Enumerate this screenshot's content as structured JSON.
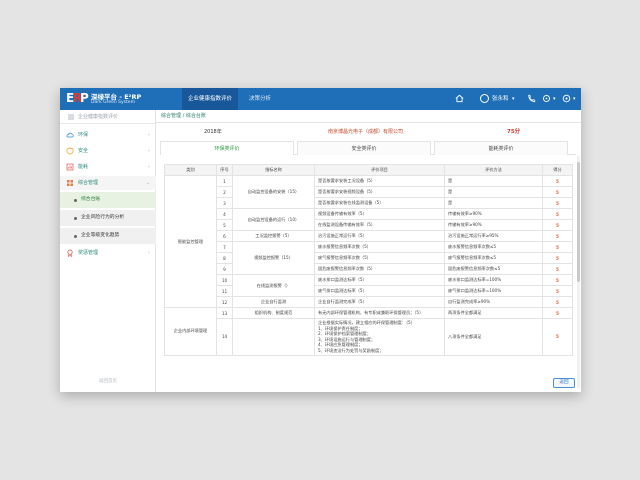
{
  "app": {
    "brand_title": "深绿平台 - E²RP",
    "brand_subtitle": "Dark Green System",
    "logo_letters": [
      "E",
      "R",
      "P"
    ]
  },
  "topnav": {
    "items": [
      {
        "label": "企业健康指数评价",
        "active": true
      },
      {
        "label": "决策分析",
        "active": false
      }
    ],
    "user_name": "张永和",
    "icons": [
      "home-icon",
      "user-icon",
      "phone-icon",
      "settings-icon",
      "help-icon"
    ]
  },
  "sidebar": {
    "title": "企业健康指数评价",
    "items": [
      {
        "label": "环保",
        "icon": "cloud-icon"
      },
      {
        "label": "安全",
        "icon": "shield-icon"
      },
      {
        "label": "能耗",
        "icon": "energy-icon"
      },
      {
        "label": "综合管理",
        "icon": "grid-icon",
        "open": true
      },
      {
        "label": "奖惩管理",
        "icon": "award-icon"
      }
    ],
    "sub_items": [
      {
        "label": "综合台账",
        "active": true
      },
      {
        "label": "企业风险行为的分析",
        "active": false
      },
      {
        "label": "企业等级变化趋势",
        "active": false
      }
    ],
    "footer": "返回首页"
  },
  "main": {
    "breadcrumb": "综合管理  /  综合台账",
    "year": "2018年",
    "company": "南京博晶光电子（成都）有限公司",
    "score": "75分",
    "tabs": [
      {
        "label": "环保类评价",
        "active": true
      },
      {
        "label": "安全类评价",
        "active": false
      },
      {
        "label": "能耗类评价",
        "active": false
      }
    ],
    "table": {
      "headers": [
        "类别",
        "序号",
        "指标名称",
        "评价项目",
        "评价方法",
        "得分"
      ],
      "groups": [
        {
          "category": "智能监控管理",
          "start": 0,
          "span": 12
        },
        {
          "category": "企业内部环境管理",
          "start": 12,
          "span": 2
        }
      ],
      "rows": [
        {
          "no": "1",
          "name": "",
          "item": "是否按要求安装工况设备（5）",
          "method": "是",
          "score": "5"
        },
        {
          "no": "2",
          "name": "自动监控设备的安装（15）",
          "item": "是否按要求安装视频设备（5）",
          "method": "是",
          "score": "5"
        },
        {
          "no": "3",
          "name": "",
          "item": "是否按要求安装在线监测设备（5）",
          "method": "是",
          "score": "5"
        },
        {
          "no": "4",
          "name": "自动监控设备的运行（10）",
          "item": "视频设备传输有效率（5）",
          "method": "传输有效率≥90%",
          "score": "5"
        },
        {
          "no": "5",
          "name": "",
          "item": "在线监测设备传输有效率（5）",
          "method": "传输有效率≥90%",
          "score": "5"
        },
        {
          "no": "6",
          "name": "工况监控报警（5）",
          "item": "治污设施正常运行率（5）",
          "method": "治污设施正常运行率≥95%",
          "score": "5"
        },
        {
          "no": "7",
          "name": "",
          "item": "废水报警信息频率次数（5）",
          "method": "废水报警信息频率次数≤5",
          "score": "5"
        },
        {
          "no": "8",
          "name": "视频监控报警（15）",
          "item": "废气报警信息频率次数（5）",
          "method": "废气报警信息频率次数≤5",
          "score": "5"
        },
        {
          "no": "9",
          "name": "",
          "item": "固危废报警信息频率次数（5）",
          "method": "固危废报警信息频率次数≤5",
          "score": "5"
        },
        {
          "no": "10",
          "name": "在线监测报警（）",
          "item": "废水排口监测达标率（5）",
          "method": "废水排口监测达标率=100%",
          "score": "5"
        },
        {
          "no": "11",
          "name": "",
          "item": "废气排口监测达标率（5）",
          "method": "废气排口监测达标率=100%",
          "score": "5"
        },
        {
          "no": "12",
          "name": "企业自行监测",
          "item": "企业自行监测完成率（5）",
          "method": "自行监测完成率≥90%",
          "score": "5"
        },
        {
          "no": "13",
          "name": "组织机构、制度规范",
          "item": "有无内部环保管理机构，有专职或兼职环保管理员；（5）",
          "method": "两项条件全都满足",
          "score": "5"
        },
        {
          "no": "14",
          "name": "",
          "item_lines": [
            "企业根据实际情况，建立相应的环保管理制度：（5）",
            "1、环境保护责任制度；",
            "2、环境保护档案管理制度；",
            "3、环境设施运行与管理制度；",
            "4、环境应急管理制度；",
            "5、环境违法行为处罚与奖励制度；"
          ],
          "method": "八项条件全都满足",
          "score": "5"
        }
      ]
    },
    "return_button": "返回"
  }
}
